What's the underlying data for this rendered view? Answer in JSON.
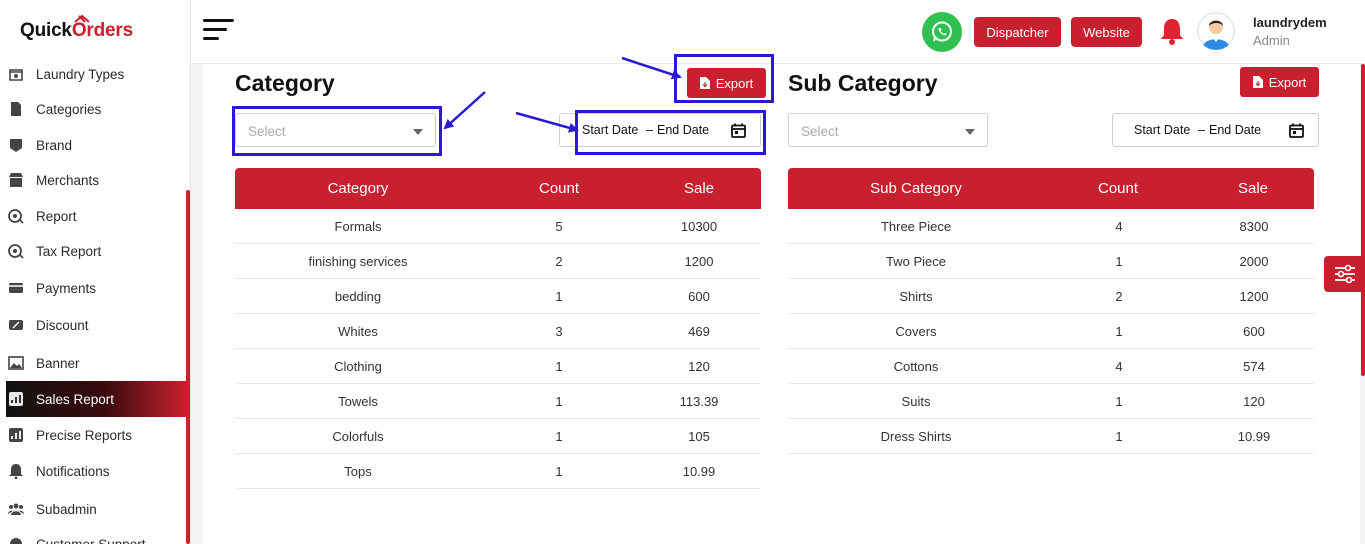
{
  "brand": {
    "name_prefix": "Quick",
    "name_suffix": "rders",
    "name_o": "O"
  },
  "sidebar": {
    "items": [
      {
        "label": "Laundry Types",
        "icon": "laundry-icon"
      },
      {
        "label": "Categories",
        "icon": "categories-icon"
      },
      {
        "label": "Brand",
        "icon": "brand-icon"
      },
      {
        "label": "Merchants",
        "icon": "merchants-icon"
      },
      {
        "label": "Report",
        "icon": "report-icon"
      },
      {
        "label": "Tax Report",
        "icon": "tax-report-icon"
      },
      {
        "label": "Payments",
        "icon": "payments-icon"
      },
      {
        "label": "Discount",
        "icon": "discount-icon"
      },
      {
        "label": "Banner",
        "icon": "banner-icon"
      },
      {
        "label": "Sales Report",
        "icon": "sales-report-icon",
        "active": true
      },
      {
        "label": "Precise Reports",
        "icon": "precise-reports-icon"
      },
      {
        "label": "Notifications",
        "icon": "bell-icon"
      },
      {
        "label": "Subadmin",
        "icon": "subadmin-icon"
      },
      {
        "label": "Customer Support",
        "icon": "support-icon"
      }
    ]
  },
  "header": {
    "dispatcher_label": "Dispatcher",
    "website_label": "Website",
    "user_name": "laundrydem",
    "user_role": "Admin"
  },
  "category": {
    "title": "Category",
    "export_label": "Export",
    "select_placeholder": "Select",
    "start_date": "Start Date",
    "date_sep": "–",
    "end_date": "End Date",
    "columns": [
      "Category",
      "Count",
      "Sale"
    ],
    "rows": [
      [
        "Formals",
        "5",
        "10300"
      ],
      [
        "finishing services",
        "2",
        "1200"
      ],
      [
        "bedding",
        "1",
        "600"
      ],
      [
        "Whites",
        "3",
        "469"
      ],
      [
        "Clothing",
        "1",
        "120"
      ],
      [
        "Towels",
        "1",
        "113.39"
      ],
      [
        "Colorfuls",
        "1",
        "105"
      ],
      [
        "Tops",
        "1",
        "10.99"
      ]
    ]
  },
  "subcategory": {
    "title": "Sub Category",
    "export_label": "Export",
    "select_placeholder": "Select",
    "start_date": "Start Date",
    "date_sep": "–",
    "end_date": "End Date",
    "columns": [
      "Sub Category",
      "Count",
      "Sale"
    ],
    "rows": [
      [
        "Three Piece",
        "4",
        "8300"
      ],
      [
        "Two Piece",
        "1",
        "2000"
      ],
      [
        "Shirts",
        "2",
        "1200"
      ],
      [
        "Covers",
        "1",
        "600"
      ],
      [
        "Cottons",
        "4",
        "574"
      ],
      [
        "Suits",
        "1",
        "120"
      ],
      [
        "Dress Shirts",
        "1",
        "10.99"
      ]
    ]
  },
  "colors": {
    "brand_red": "#c8202e",
    "highlight_blue": "#2a17d8",
    "whatsapp_green": "#2fc04f"
  }
}
